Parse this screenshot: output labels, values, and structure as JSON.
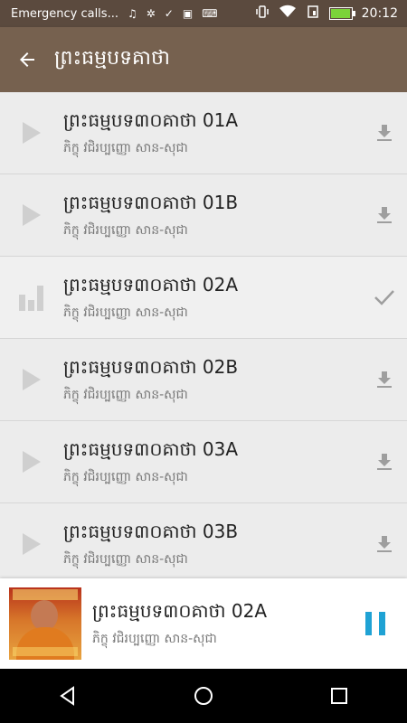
{
  "status_bar": {
    "notification_text": "Emergency calls...",
    "time": "20:12"
  },
  "app_bar": {
    "title": "ព្រះធម្មបទគាថា"
  },
  "tracks": [
    {
      "title": "ព្រះធម្មបទ៣០គាថា 01A",
      "subtitle": "ភិក្ខុ វជិរប្បញ្ញោ សាន-សុជា",
      "state": "download"
    },
    {
      "title": "ព្រះធម្មបទ៣០គាថា 01B",
      "subtitle": "ភិក្ខុ វជិរប្បញ្ញោ សាន-សុជា",
      "state": "download"
    },
    {
      "title": "ព្រះធម្មបទ៣០គាថា 02A",
      "subtitle": "ភិក្ខុ វជិរប្បញ្ញោ សាន-សុជា",
      "state": "downloaded"
    },
    {
      "title": "ព្រះធម្មបទ៣០គាថា 02B",
      "subtitle": "ភិក្ខុ វជិរប្បញ្ញោ សាន-សុជា",
      "state": "download"
    },
    {
      "title": "ព្រះធម្មបទ៣០គាថា 03A",
      "subtitle": "ភិក្ខុ វជិរប្បញ្ញោ សាន-សុជា",
      "state": "download"
    },
    {
      "title": "ព្រះធម្មបទ៣០គាថា 03B",
      "subtitle": "ភិក្ខុ វជិរប្បញ្ញោ សាន-សុជា",
      "state": "download"
    }
  ],
  "now_playing": {
    "title": "ព្រះធម្មបទ៣០គាថា 02A",
    "subtitle": "ភិក្ខុ វជិរប្បញ្ញោ សាន-សុជា"
  },
  "colors": {
    "status_bar": "#5b4a3e",
    "app_bar": "#76614f",
    "accent": "#1fa2d4",
    "icon_gray": "#9e9e9e"
  },
  "icons": {
    "back": "arrow-left-icon",
    "play": "play-icon",
    "equalizer": "equalizer-icon",
    "download": "download-icon",
    "check": "check-icon",
    "pause": "pause-icon",
    "nav_back": "nav-back-icon",
    "nav_home": "nav-home-icon",
    "nav_recents": "nav-recents-icon"
  }
}
